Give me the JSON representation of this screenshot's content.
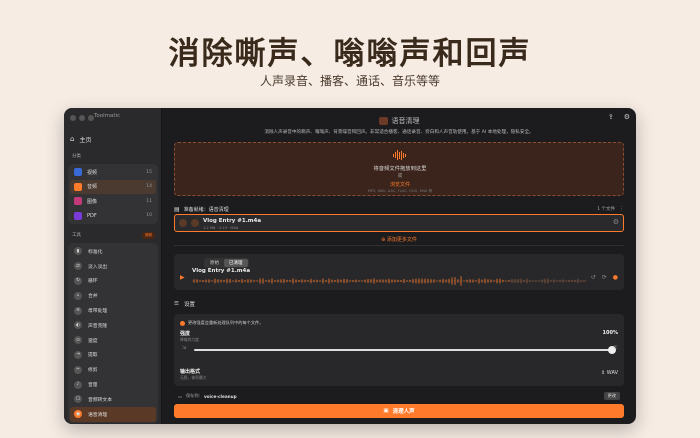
{
  "hero": {
    "title": "消除嘶声、嗡嗡声和回声",
    "subtitle": "人声录音、播客、通话、音乐等等"
  },
  "window": {
    "app_name": "Toolmatic",
    "accent": "#ff7a2a"
  },
  "sidebar": {
    "home_label": "主页",
    "categories_label": "分类",
    "categories": [
      {
        "label": "视频",
        "count": "15",
        "icon": "video-icon",
        "color": "#3a6ad8"
      },
      {
        "label": "音频",
        "count": "14",
        "icon": "audio-icon",
        "color": "#ff7a2a"
      },
      {
        "label": "图像",
        "count": "11",
        "icon": "image-icon",
        "color": "#c23a7a"
      },
      {
        "label": "PDF",
        "count": "10",
        "icon": "pdf-icon",
        "color": "#7a3ad8"
      }
    ],
    "tools_label": "工具",
    "tools_badge": "音频",
    "tools": [
      {
        "label": "标准化",
        "icon": "normalize-icon"
      },
      {
        "label": "淡入淡出",
        "icon": "fade-icon"
      },
      {
        "label": "循环",
        "icon": "loop-icon"
      },
      {
        "label": "合并",
        "icon": "merge-icon"
      },
      {
        "label": "母带处理",
        "icon": "mastering-icon"
      },
      {
        "label": "声音克隆",
        "icon": "clone-icon"
      },
      {
        "label": "速度",
        "icon": "speed-icon"
      },
      {
        "label": "提取",
        "icon": "extract-icon"
      },
      {
        "label": "修剪",
        "icon": "trim-icon"
      },
      {
        "label": "音量",
        "icon": "volume-icon"
      },
      {
        "label": "音频转文本",
        "icon": "transcribe-icon"
      },
      {
        "label": "语音清理",
        "icon": "voice-clean-icon"
      }
    ]
  },
  "main": {
    "feature_title": "语音清理",
    "feature_desc": "消除人声录音中的嘶声、嗡嗡声、背景噪音和回声。非常适合播客、通话录音、旁白和人声音轨使用。基于 AI 本地处理，隐私安全。",
    "dropzone": {
      "main": "将音频文件拖放到这里",
      "or": "或",
      "browse": "浏览文件",
      "formats": "MP3, WAV, AAC, FLAC, OGG, M4A 等"
    },
    "queue": {
      "title": "准备就绪：语音清理",
      "count": "1 个文件",
      "file_name": "Vlog Entry #1.m4a",
      "file_meta": "1.2 MB · 1:19 · M4A",
      "add_more": "添加更多文件"
    },
    "preview": {
      "tab_original": "原始",
      "tab_cleaned": "已清理",
      "file_name": "Vlog Entry #1.m4a"
    },
    "settings": {
      "title": "设置",
      "warning": "更改强度会重新处理队列中的每个文件。",
      "strength_label": "强度",
      "strength_sub": "降噪的力度",
      "strength_value": "100%",
      "strength_fraction": 1.0,
      "output_label": "输出格式",
      "output_sub": "无损，体积最大",
      "output_value": "WAV"
    },
    "output_folder": {
      "label": "保存到:",
      "path": "voice-cleanup",
      "change": "更改"
    },
    "action_label": "清理人声"
  }
}
